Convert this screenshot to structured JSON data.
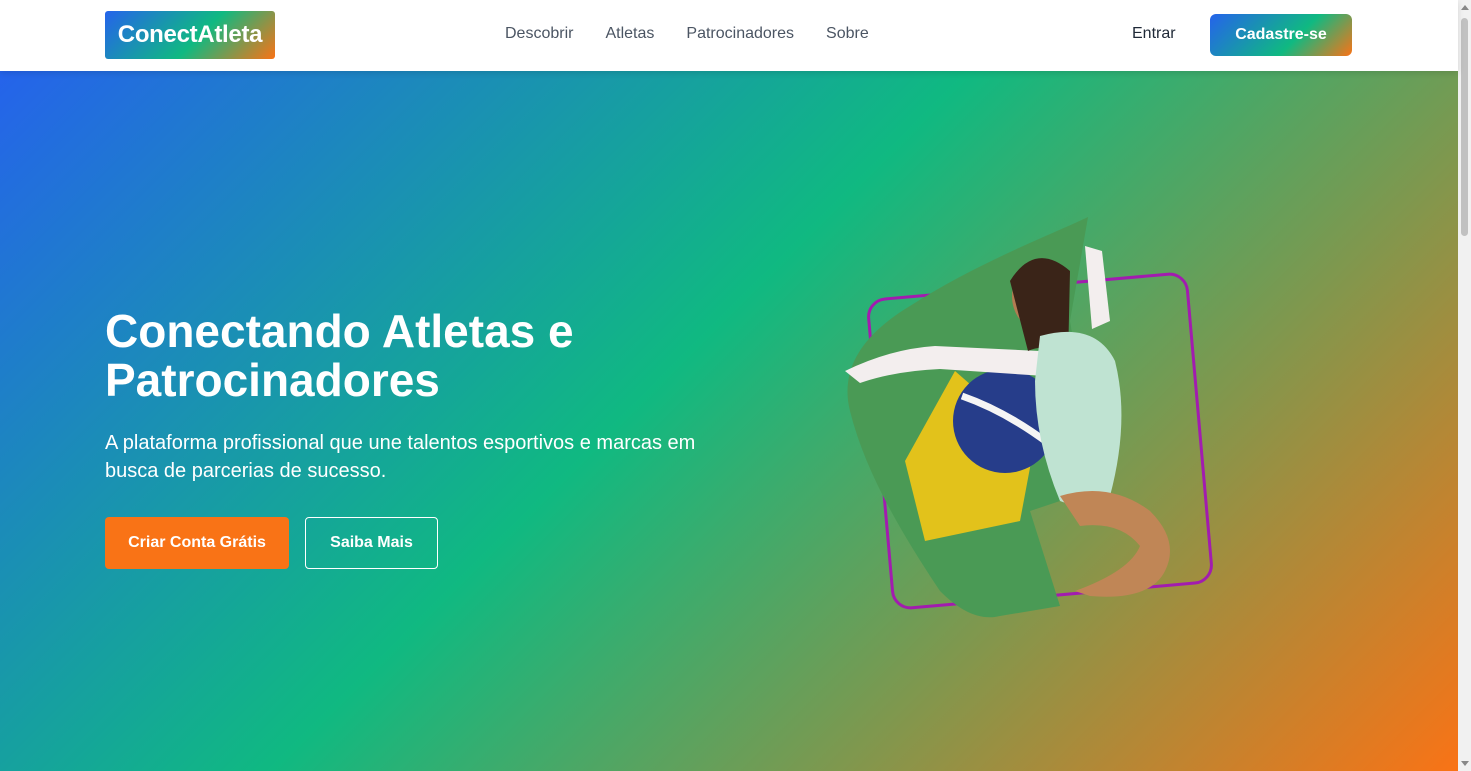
{
  "header": {
    "logo": "ConectAtleta",
    "nav": [
      "Descobrir",
      "Atletas",
      "Patrocinadores",
      "Sobre"
    ],
    "login_label": "Entrar",
    "signup_label": "Cadastre-se"
  },
  "hero": {
    "title": "Conectando Atletas e Patrocinadores",
    "subtitle": "A plataforma profissional que une talentos esportivos e marcas em busca de parcerias de sucesso.",
    "primary_cta": "Criar Conta Grátis",
    "secondary_cta": "Saiba Mais",
    "image_icon": "athlete-with-flag-image"
  },
  "colors": {
    "brand_blue": "#2563eb",
    "brand_green": "#10b981",
    "brand_orange": "#f97316",
    "frame_purple": "#a21caf"
  }
}
